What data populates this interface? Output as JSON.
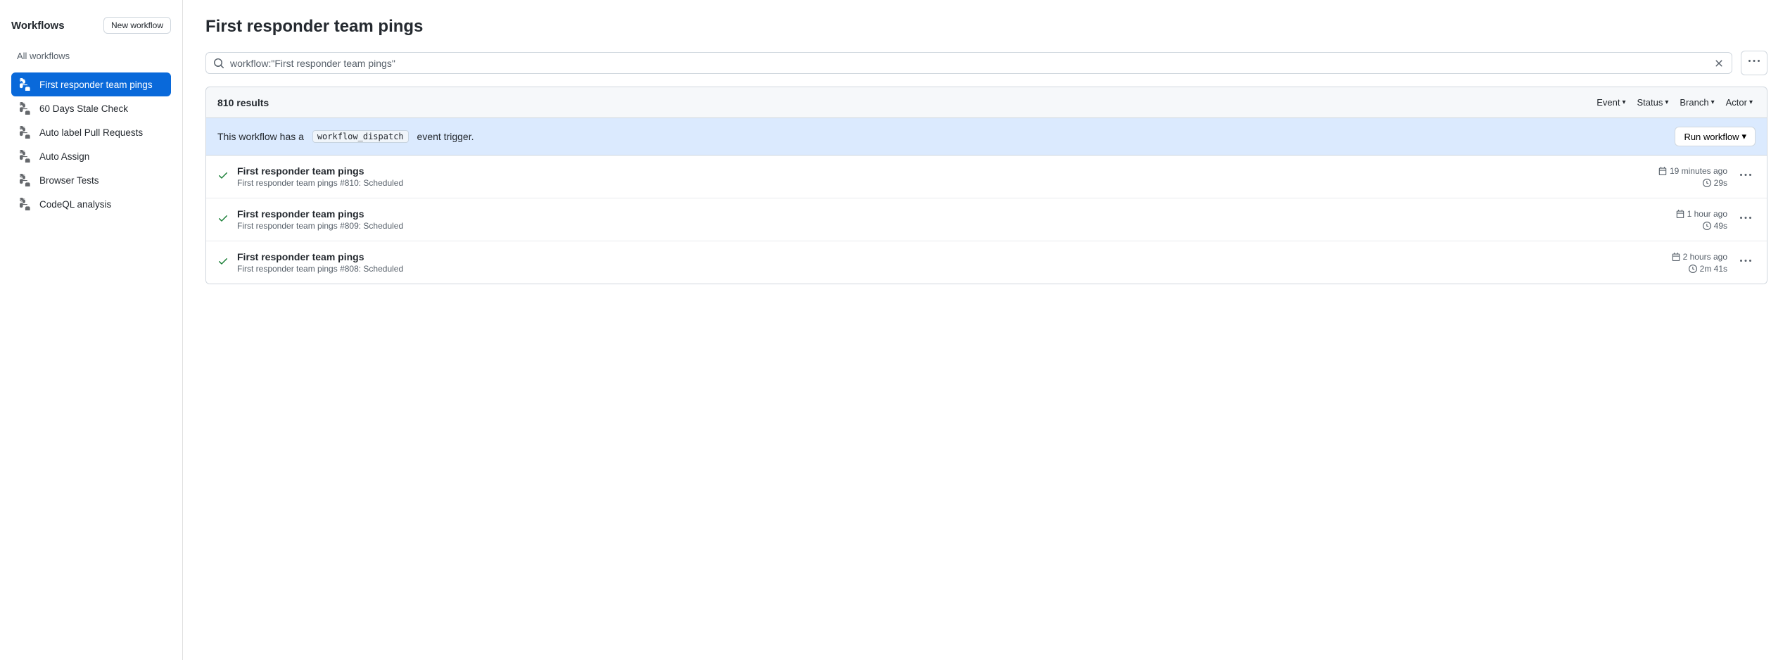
{
  "sidebar": {
    "title": "Workflows",
    "new_workflow_label": "New workflow",
    "all_workflows_label": "All workflows",
    "items": [
      {
        "id": "first-responder-team-pings",
        "label": "First responder team pings",
        "active": true
      },
      {
        "id": "60-days-stale-check",
        "label": "60 Days Stale Check",
        "active": false
      },
      {
        "id": "auto-label-pull-requests",
        "label": "Auto label Pull Requests",
        "active": false
      },
      {
        "id": "auto-assign",
        "label": "Auto Assign",
        "active": false
      },
      {
        "id": "browser-tests",
        "label": "Browser Tests",
        "active": false
      },
      {
        "id": "codeql-analysis",
        "label": "CodeQL analysis",
        "active": false
      }
    ]
  },
  "main": {
    "title": "First responder team pings",
    "search": {
      "value": "workflow:\"First responder team pings\"",
      "placeholder": "Search workflow runs"
    },
    "results_count": "810 results",
    "filters": [
      {
        "id": "event",
        "label": "Event"
      },
      {
        "id": "status",
        "label": "Status"
      },
      {
        "id": "branch",
        "label": "Branch"
      },
      {
        "id": "actor",
        "label": "Actor"
      }
    ],
    "dispatch_banner": {
      "text_before": "This workflow has a",
      "code": "workflow_dispatch",
      "text_after": "event trigger.",
      "run_workflow_label": "Run workflow"
    },
    "runs": [
      {
        "name": "First responder team pings",
        "subtitle": "First responder team pings #810: Scheduled",
        "time": "19 minutes ago",
        "duration": "29s"
      },
      {
        "name": "First responder team pings",
        "subtitle": "First responder team pings #809: Scheduled",
        "time": "1 hour ago",
        "duration": "49s"
      },
      {
        "name": "First responder team pings",
        "subtitle": "First responder team pings #808: Scheduled",
        "time": "2 hours ago",
        "duration": "2m 41s"
      }
    ]
  },
  "colors": {
    "active_bg": "#0969da",
    "success": "#1a7f37",
    "banner_bg": "#dbeafe"
  }
}
